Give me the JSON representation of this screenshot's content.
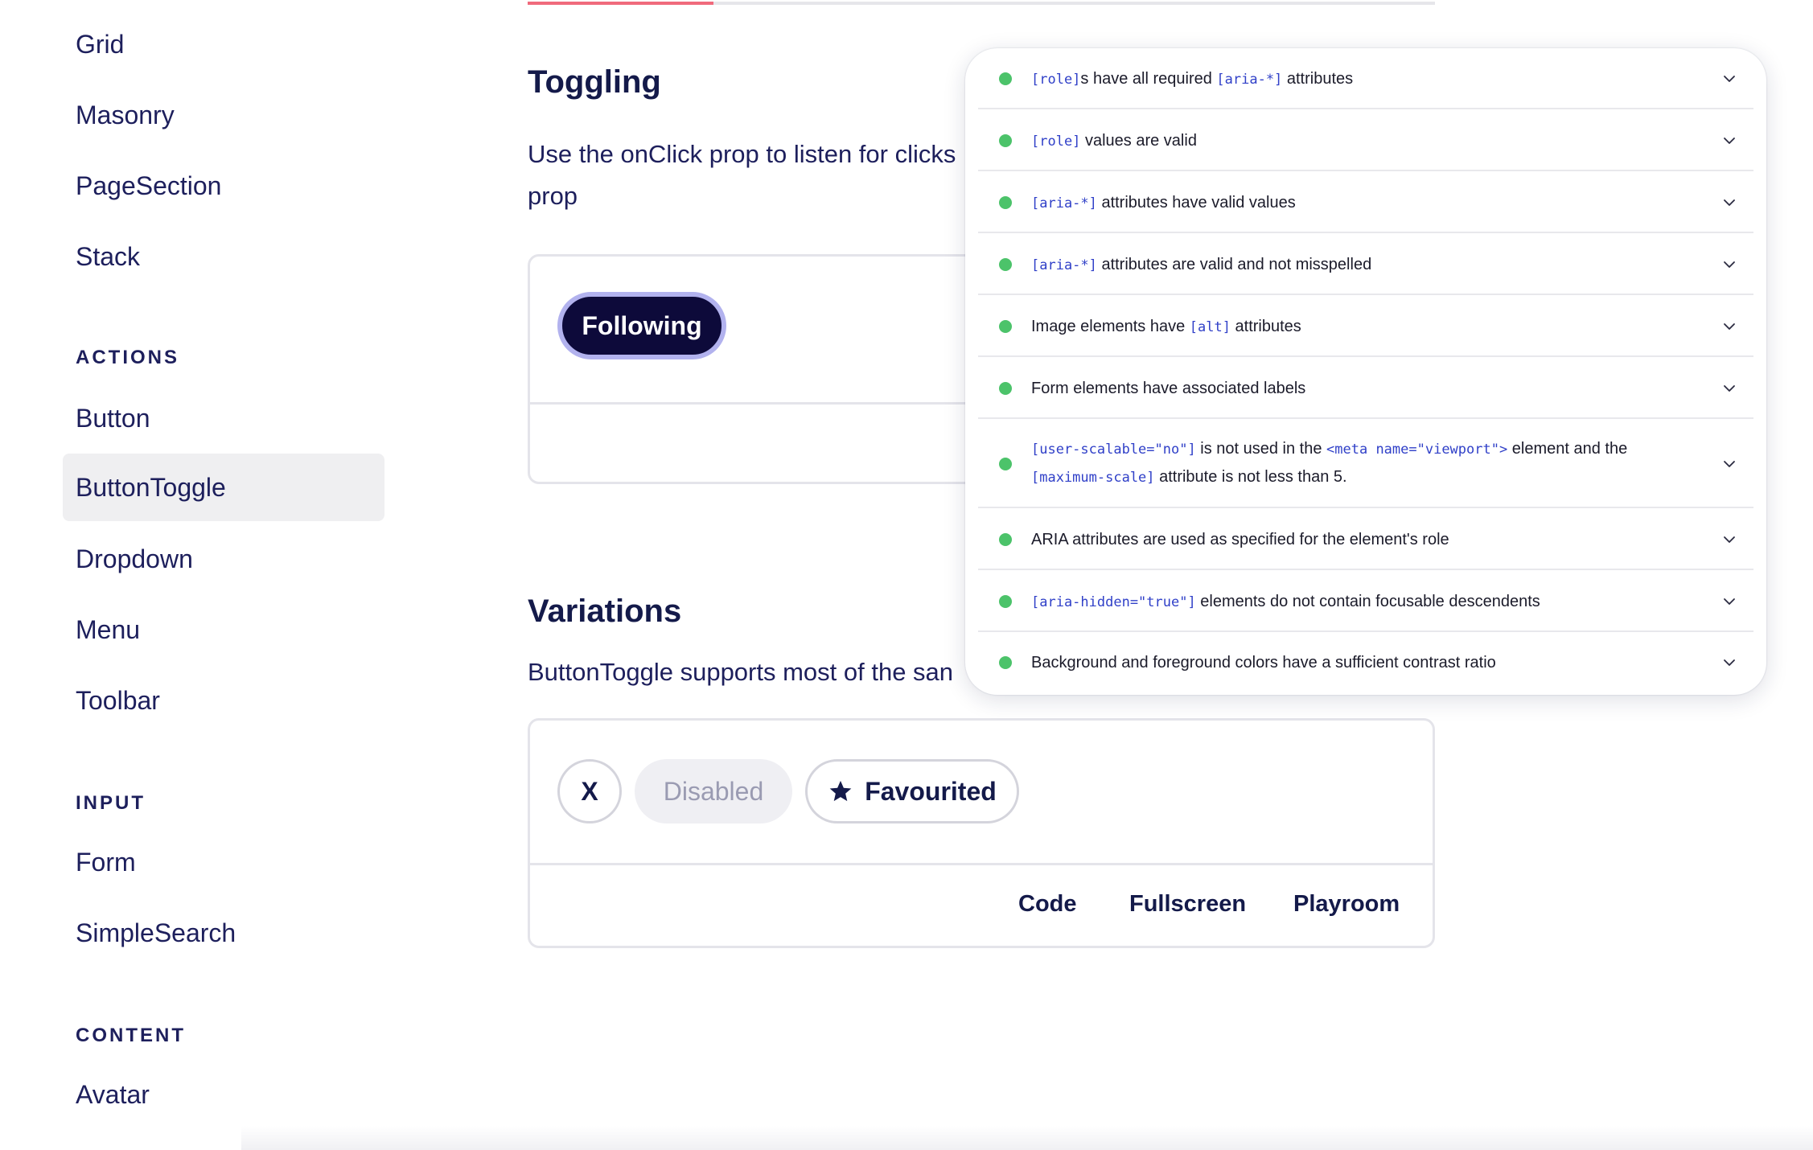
{
  "sidebar": {
    "items_top": [
      {
        "label": "Grid"
      },
      {
        "label": "Masonry"
      },
      {
        "label": "PageSection"
      },
      {
        "label": "Stack"
      }
    ],
    "sections": [
      {
        "heading": "ACTIONS",
        "items": [
          "Button",
          "ButtonToggle",
          "Dropdown",
          "Menu",
          "Toolbar"
        ]
      },
      {
        "heading": "INPUT",
        "items": [
          "Form",
          "SimpleSearch"
        ]
      },
      {
        "heading": "CONTENT",
        "items": [
          "Avatar"
        ]
      }
    ],
    "active_item": "ButtonToggle"
  },
  "page": {
    "scroll_progress_percent": 20.5,
    "accent_color": "#f06a7c",
    "toggling": {
      "title": "Toggling",
      "text_line1": "Use the onClick prop to listen for clicks",
      "text_line2": "prop",
      "example_button": "Following"
    },
    "variations": {
      "title": "Variations",
      "text": "ButtonToggle supports most of the san",
      "btn_x": "X",
      "btn_disabled": "Disabled",
      "btn_favourited": "Favourited",
      "star_icon": "star-icon",
      "footer_links": [
        "Code",
        "Fullscreen",
        "Playroom"
      ]
    }
  },
  "a11y_panel": {
    "status_color": "#4cc36a",
    "checks": [
      {
        "parts": [
          [
            "code",
            "[role]"
          ],
          [
            "text",
            "s have all required "
          ],
          [
            "code",
            "[aria-*]"
          ],
          [
            "text",
            " attributes"
          ]
        ]
      },
      {
        "parts": [
          [
            "code",
            "[role]"
          ],
          [
            "text",
            " values are valid"
          ]
        ]
      },
      {
        "parts": [
          [
            "code",
            "[aria-*]"
          ],
          [
            "text",
            " attributes have valid values"
          ]
        ]
      },
      {
        "parts": [
          [
            "code",
            "[aria-*]"
          ],
          [
            "text",
            " attributes are valid and not misspelled"
          ]
        ]
      },
      {
        "parts": [
          [
            "text",
            "Image elements have "
          ],
          [
            "code",
            "[alt]"
          ],
          [
            "text",
            " attributes"
          ]
        ]
      },
      {
        "parts": [
          [
            "text",
            "Form elements have associated labels"
          ]
        ]
      },
      {
        "parts": [
          [
            "code",
            "[user-scalable=\"no\"]"
          ],
          [
            "text",
            " is not used in the "
          ],
          [
            "code",
            "<meta name=\"viewport\">"
          ],
          [
            "text",
            " element and the"
          ]
        ],
        "parts2": [
          [
            "code",
            "[maximum-scale]"
          ],
          [
            "text",
            " attribute is not less than 5."
          ]
        ]
      },
      {
        "parts": [
          [
            "text",
            "ARIA attributes are used as specified for the element's role"
          ]
        ]
      },
      {
        "parts": [
          [
            "code",
            "[aria-hidden=\"true\"]"
          ],
          [
            "text",
            " elements do not contain focusable descendents"
          ]
        ]
      },
      {
        "parts": [
          [
            "text",
            "Background and foreground colors have a sufficient contrast ratio"
          ]
        ]
      }
    ]
  }
}
